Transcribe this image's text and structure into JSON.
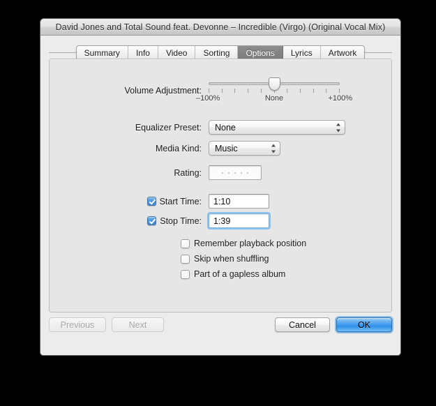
{
  "window": {
    "title": "David Jones and Total Sound feat. Devonne – Incredible (Virgo) (Original Vocal Mix)"
  },
  "tabs": [
    {
      "label": "Summary",
      "selected": false
    },
    {
      "label": "Info",
      "selected": false
    },
    {
      "label": "Video",
      "selected": false
    },
    {
      "label": "Sorting",
      "selected": false
    },
    {
      "label": "Options",
      "selected": true
    },
    {
      "label": "Lyrics",
      "selected": false
    },
    {
      "label": "Artwork",
      "selected": false
    }
  ],
  "options": {
    "volume": {
      "label": "Volume Adjustment:",
      "min_label": "–100%",
      "mid_label": "None",
      "max_label": "+100%",
      "value_percent": 0,
      "thumb_position_percent": 50,
      "tick_count": 11
    },
    "equalizer": {
      "label": "Equalizer Preset:",
      "value": "None"
    },
    "media_kind": {
      "label": "Media Kind:",
      "value": "Music"
    },
    "rating": {
      "label": "Rating:",
      "stars": 0,
      "max_stars": 5
    },
    "start_time": {
      "label": "Start Time:",
      "checked": true,
      "value": "1:10",
      "focused": false
    },
    "stop_time": {
      "label": "Stop Time:",
      "checked": true,
      "value": "1:39",
      "focused": true
    },
    "checkboxes": [
      {
        "label": "Remember playback position",
        "checked": false
      },
      {
        "label": "Skip when shuffling",
        "checked": false
      },
      {
        "label": "Part of a gapless album",
        "checked": false
      }
    ]
  },
  "buttons": {
    "previous": {
      "label": "Previous",
      "state": "disabled"
    },
    "next": {
      "label": "Next",
      "state": "disabled"
    },
    "cancel": {
      "label": "Cancel",
      "state": "normal"
    },
    "ok": {
      "label": "OK",
      "state": "default"
    }
  },
  "colors": {
    "accent_blue": "#3f9aec",
    "selected_tab": "#838383",
    "window_bg": "#ececec",
    "panel_bg": "#e6e6e6",
    "frame": "#000000"
  }
}
